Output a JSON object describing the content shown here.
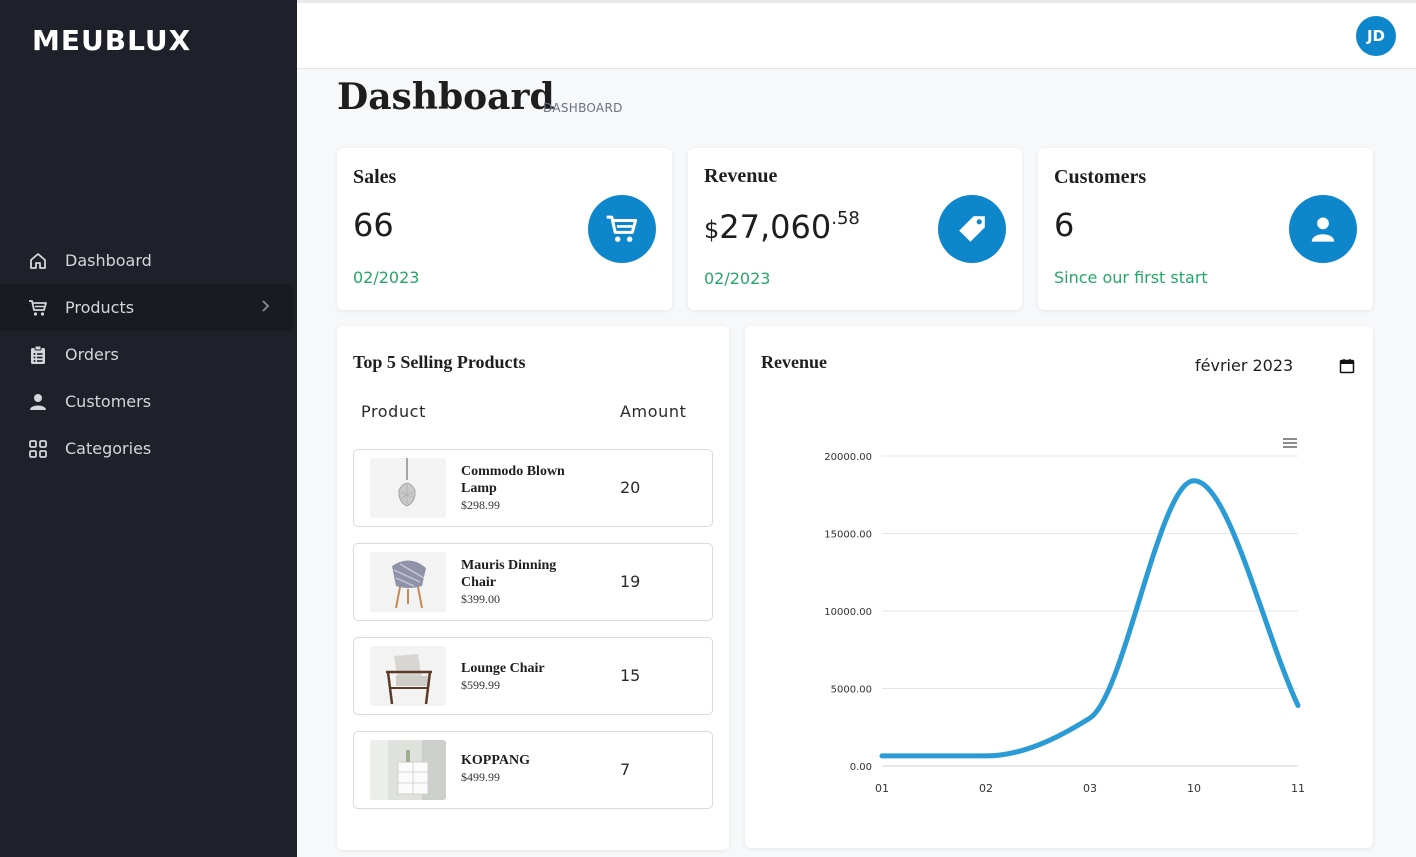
{
  "app": {
    "brand": "MEUBLUX",
    "user_initials": "JD"
  },
  "sidebar": {
    "items": [
      {
        "label": "Dashboard",
        "icon": "home-icon"
      },
      {
        "label": "Products",
        "icon": "cart-icon",
        "active": true,
        "has_submenu": true
      },
      {
        "label": "Orders",
        "icon": "clipboard-icon"
      },
      {
        "label": "Customers",
        "icon": "user-icon"
      },
      {
        "label": "Categories",
        "icon": "grid-icon"
      }
    ]
  },
  "header": {
    "title": "Dashboard",
    "breadcrumb": "DASHBOARD"
  },
  "stats": {
    "sales": {
      "title": "Sales",
      "value": "66",
      "sub": "02/2023",
      "icon": "cart-icon"
    },
    "revenue": {
      "title": "Revenue",
      "currency": "$",
      "value": "27,060",
      "cents": ".58",
      "sub": "02/2023",
      "icon": "tag-icon"
    },
    "customers": {
      "title": "Customers",
      "value": "6",
      "sub": "Since our first start",
      "icon": "user-icon"
    }
  },
  "top_products": {
    "title": "Top 5 Selling Products",
    "col_product": "Product",
    "col_amount": "Amount",
    "rows": [
      {
        "name": "Commodo Blown Lamp",
        "price": "$298.99",
        "amount": "20"
      },
      {
        "name": "Mauris Dinning Chair",
        "price": "$399.00",
        "amount": "19"
      },
      {
        "name": "Lounge Chair",
        "price": "$599.99",
        "amount": "15"
      },
      {
        "name": "KOPPANG",
        "price": "$499.99",
        "amount": "7"
      }
    ]
  },
  "revenue_chart": {
    "title": "Revenue",
    "date_value": "février 2023"
  },
  "colors": {
    "accent": "#0e86cc",
    "positive": "#27a768",
    "sidebar": "#1e2129",
    "line": "#2b9bd6"
  },
  "chart_data": {
    "type": "line",
    "x": [
      "01",
      "02",
      "03",
      "10",
      "11"
    ],
    "series": [
      {
        "values": [
          650,
          650,
          3100,
          18400,
          3900
        ]
      }
    ],
    "ylim": [
      0,
      20000
    ],
    "yticks": [
      "0.00",
      "5000.00",
      "10000.00",
      "15000.00",
      "20000.00"
    ],
    "grid": true,
    "smooth": true
  }
}
